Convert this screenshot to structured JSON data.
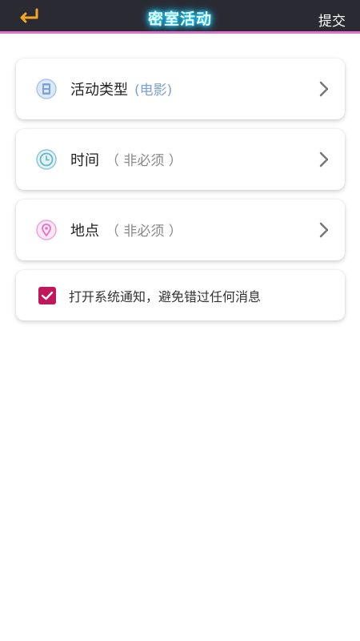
{
  "header": {
    "title": "密室活动",
    "submit_label": "提交",
    "back_icon": "return-arrow-icon",
    "back_icon_color": "#f5a623",
    "title_glow_color": "#22d6ff",
    "accent_line_color": "#e070c8"
  },
  "items": [
    {
      "label": "活动类型",
      "hint": "(电影)",
      "icon": "film-icon",
      "icon_color": "#7aa2d6"
    },
    {
      "label": "时间",
      "hint": "（ 非必须 ）",
      "icon": "clock-icon",
      "icon_color": "#6bb5c8"
    },
    {
      "label": "地点",
      "hint": "（ 非必须 ）",
      "icon": "location-pin-icon",
      "icon_color": "#e070c8"
    }
  ],
  "notification": {
    "checked": true,
    "label": "打开系统通知，避免错过任何消息",
    "check_color": "#c2185b"
  }
}
